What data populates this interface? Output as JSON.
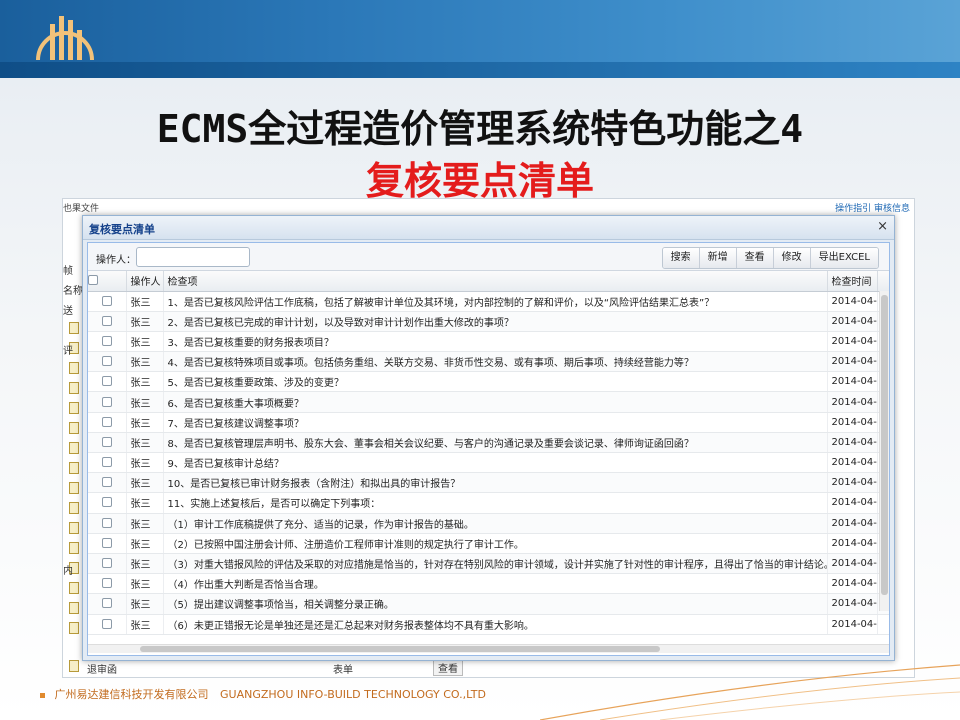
{
  "slide": {
    "title_line1": "ECMS全过程造价管理系统特色功能之4",
    "title_line2": "复核要点清单",
    "footer_cn": "广州易达建信科技开发有限公司",
    "footer_en": "GUANGZHOU INFO-BUILD TECHNOLOGY CO.,LTD"
  },
  "background_app": {
    "top_left": "也果文件",
    "top_right": "操作指引  审核信息",
    "side_rows": [
      "帧",
      "名称",
      "送",
      "",
      "评",
      "",
      "",
      "",
      "",
      "",
      "",
      "",
      "",
      "",
      "",
      "内",
      "",
      "",
      ""
    ],
    "bottom_row": {
      "name": "退审函",
      "type": "表单",
      "action": "查看"
    }
  },
  "modal": {
    "title": "复核要点清单",
    "close": "×",
    "operator_label": "操作人：",
    "operator_value": "",
    "buttons": [
      "搜索",
      "新增",
      "查看",
      "修改",
      "导出EXCEL"
    ],
    "columns": {
      "operator": "操作人",
      "item": "检查项",
      "time": "检查时间"
    },
    "rows": [
      {
        "operator": "张三",
        "item": "1、是否已复核风险评估工作底稿，包括了解被审计单位及其环境，对内部控制的了解和评价，以及“风险评估结果汇总表”？",
        "time": "2014-04-"
      },
      {
        "operator": "张三",
        "item": "2、是否已复核已完成的审计计划，以及导致对审计计划作出重大修改的事项？",
        "time": "2014-04-"
      },
      {
        "operator": "张三",
        "item": "3、是否已复核重要的财务报表项目？",
        "time": "2014-04-"
      },
      {
        "operator": "张三",
        "item": "4、是否已复核特殊项目或事项。包括债务重组、关联方交易、非货币性交易、或有事项、期后事项、持续经营能力等？",
        "time": "2014-04-"
      },
      {
        "operator": "张三",
        "item": "5、是否已复核重要政策、涉及的变更？",
        "time": "2014-04-"
      },
      {
        "operator": "张三",
        "item": "6、是否已复核重大事项概要？",
        "time": "2014-04-"
      },
      {
        "operator": "张三",
        "item": "7、是否已复核建议调整事项？",
        "time": "2014-04-"
      },
      {
        "operator": "张三",
        "item": "8、是否已复核管理层声明书、股东大会、董事会相关会议纪要、与客户的沟通记录及重要会谈记录、律师询证函回函？",
        "time": "2014-04-"
      },
      {
        "operator": "张三",
        "item": "9、是否已复核审计总结？",
        "time": "2014-04-"
      },
      {
        "operator": "张三",
        "item": "10、是否已复核已审计财务报表（含附注）和拟出具的审计报告？",
        "time": "2014-04-"
      },
      {
        "operator": "张三",
        "item": "11、实施上述复核后，是否可以确定下列事项：",
        "time": "2014-04-"
      },
      {
        "operator": "张三",
        "item": "（1）审计工作底稿提供了充分、适当的记录，作为审计报告的基础。",
        "time": "2014-04-"
      },
      {
        "operator": "张三",
        "item": "（2）已按照中国注册会计师、注册造价工程师审计准则的规定执行了审计工作。",
        "time": "2014-04-"
      },
      {
        "operator": "张三",
        "item": "（3）对重大错报风险的评估及采取的对应措施是恰当的，针对存在特别风险的审计领域，设计并实施了针对性的审计程序，且得出了恰当的审计结论。",
        "time": "2014-04-"
      },
      {
        "operator": "张三",
        "item": "（4）作出重大判断是否恰当合理。",
        "time": "2014-04-"
      },
      {
        "operator": "张三",
        "item": "（5）提出建议调整事项恰当，相关调整分录正确。",
        "time": "2014-04-"
      },
      {
        "operator": "张三",
        "item": "（6）未更正错报无论是单独还是还是汇总起来对财务报表整体均不具有重大影响。",
        "time": "2014-04-"
      }
    ]
  },
  "colors": {
    "title_red": "#e41c1c",
    "banner_blue": "#1a5f9c",
    "footer_orange": "#c26b1e",
    "header_text": "#15428b"
  }
}
